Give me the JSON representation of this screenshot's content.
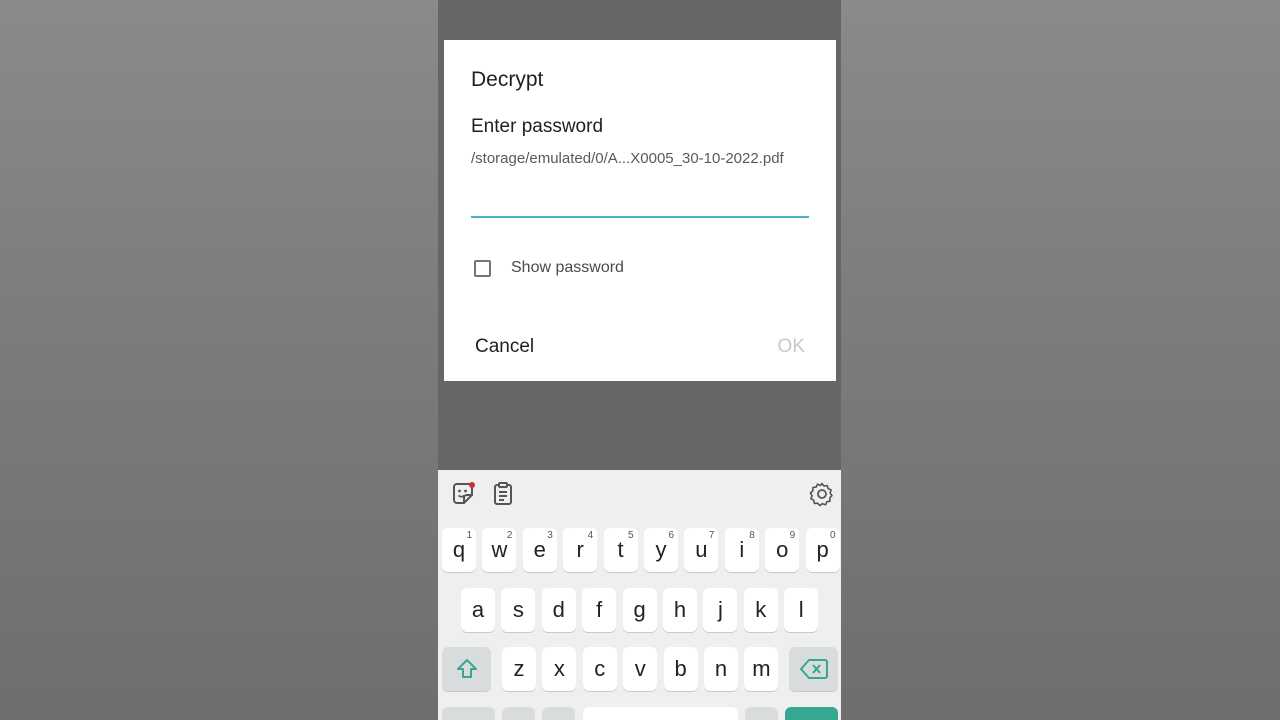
{
  "dialog": {
    "title": "Decrypt",
    "subtitle": "Enter password",
    "file_path": "/storage/emulated/0/A...X0005_30-10-2022.pdf",
    "password_value": "",
    "show_password_label": "Show password",
    "show_password_checked": false,
    "cancel_label": "Cancel",
    "ok_label": "OK"
  },
  "keyboard": {
    "toolbar_icons": [
      "sticker-icon",
      "clipboard-icon",
      "gear-icon"
    ],
    "row1": [
      {
        "key": "q",
        "hint": "1"
      },
      {
        "key": "w",
        "hint": "2"
      },
      {
        "key": "e",
        "hint": "3"
      },
      {
        "key": "r",
        "hint": "4"
      },
      {
        "key": "t",
        "hint": "5"
      },
      {
        "key": "y",
        "hint": "6"
      },
      {
        "key": "u",
        "hint": "7"
      },
      {
        "key": "i",
        "hint": "8"
      },
      {
        "key": "o",
        "hint": "9"
      },
      {
        "key": "p",
        "hint": "0"
      }
    ],
    "row2": [
      "a",
      "s",
      "d",
      "f",
      "g",
      "h",
      "j",
      "k",
      "l"
    ],
    "row3": [
      "z",
      "x",
      "c",
      "v",
      "b",
      "n",
      "m"
    ],
    "accent_color": "#37a693",
    "input_underline_color": "#4ab3c9"
  }
}
